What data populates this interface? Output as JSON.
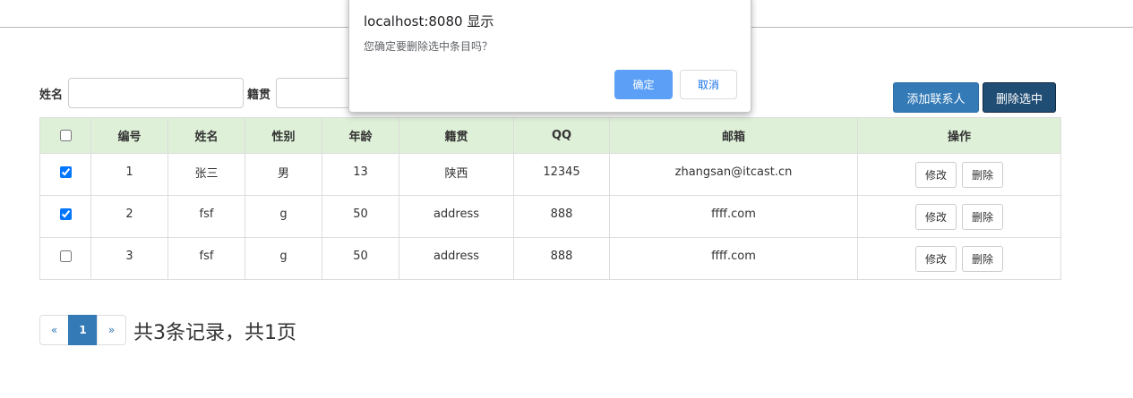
{
  "search": {
    "name_label": "姓名",
    "name_value": "",
    "origin_label": "籍贯",
    "origin_value": ""
  },
  "toolbar": {
    "add_label": "添加联系人",
    "delete_selected_label": "删除选中",
    "accent_color": "#337ab7",
    "dark_accent_color": "#204d74"
  },
  "table": {
    "header_bg": "#dff0d8",
    "columns": [
      "编号",
      "姓名",
      "性别",
      "年龄",
      "籍贯",
      "QQ",
      "邮箱",
      "操作"
    ],
    "select_all_checked": false,
    "rows": [
      {
        "checked": true,
        "id": "1",
        "name": "张三",
        "gender": "男",
        "age": "13",
        "origin": "陕西",
        "qq": "12345",
        "email": "zhangsan@itcast.cn",
        "edit_label": "修改",
        "delete_label": "删除"
      },
      {
        "checked": true,
        "id": "2",
        "name": "fsf",
        "gender": "g",
        "age": "50",
        "origin": "address",
        "qq": "888",
        "email": "ffff.com",
        "edit_label": "修改",
        "delete_label": "删除"
      },
      {
        "checked": false,
        "id": "3",
        "name": "fsf",
        "gender": "g",
        "age": "50",
        "origin": "address",
        "qq": "888",
        "email": "ffff.com",
        "edit_label": "修改",
        "delete_label": "删除"
      }
    ]
  },
  "pagination": {
    "prev_label": "«",
    "current_page": "1",
    "next_label": "»",
    "summary": "共3条记录，共1页"
  },
  "dialog": {
    "title": "localhost:8080 显示",
    "message": "您确定要删除选中条目吗？",
    "ok_label": "确定",
    "cancel_label": "取消",
    "ok_color": "#5ba0f6"
  }
}
